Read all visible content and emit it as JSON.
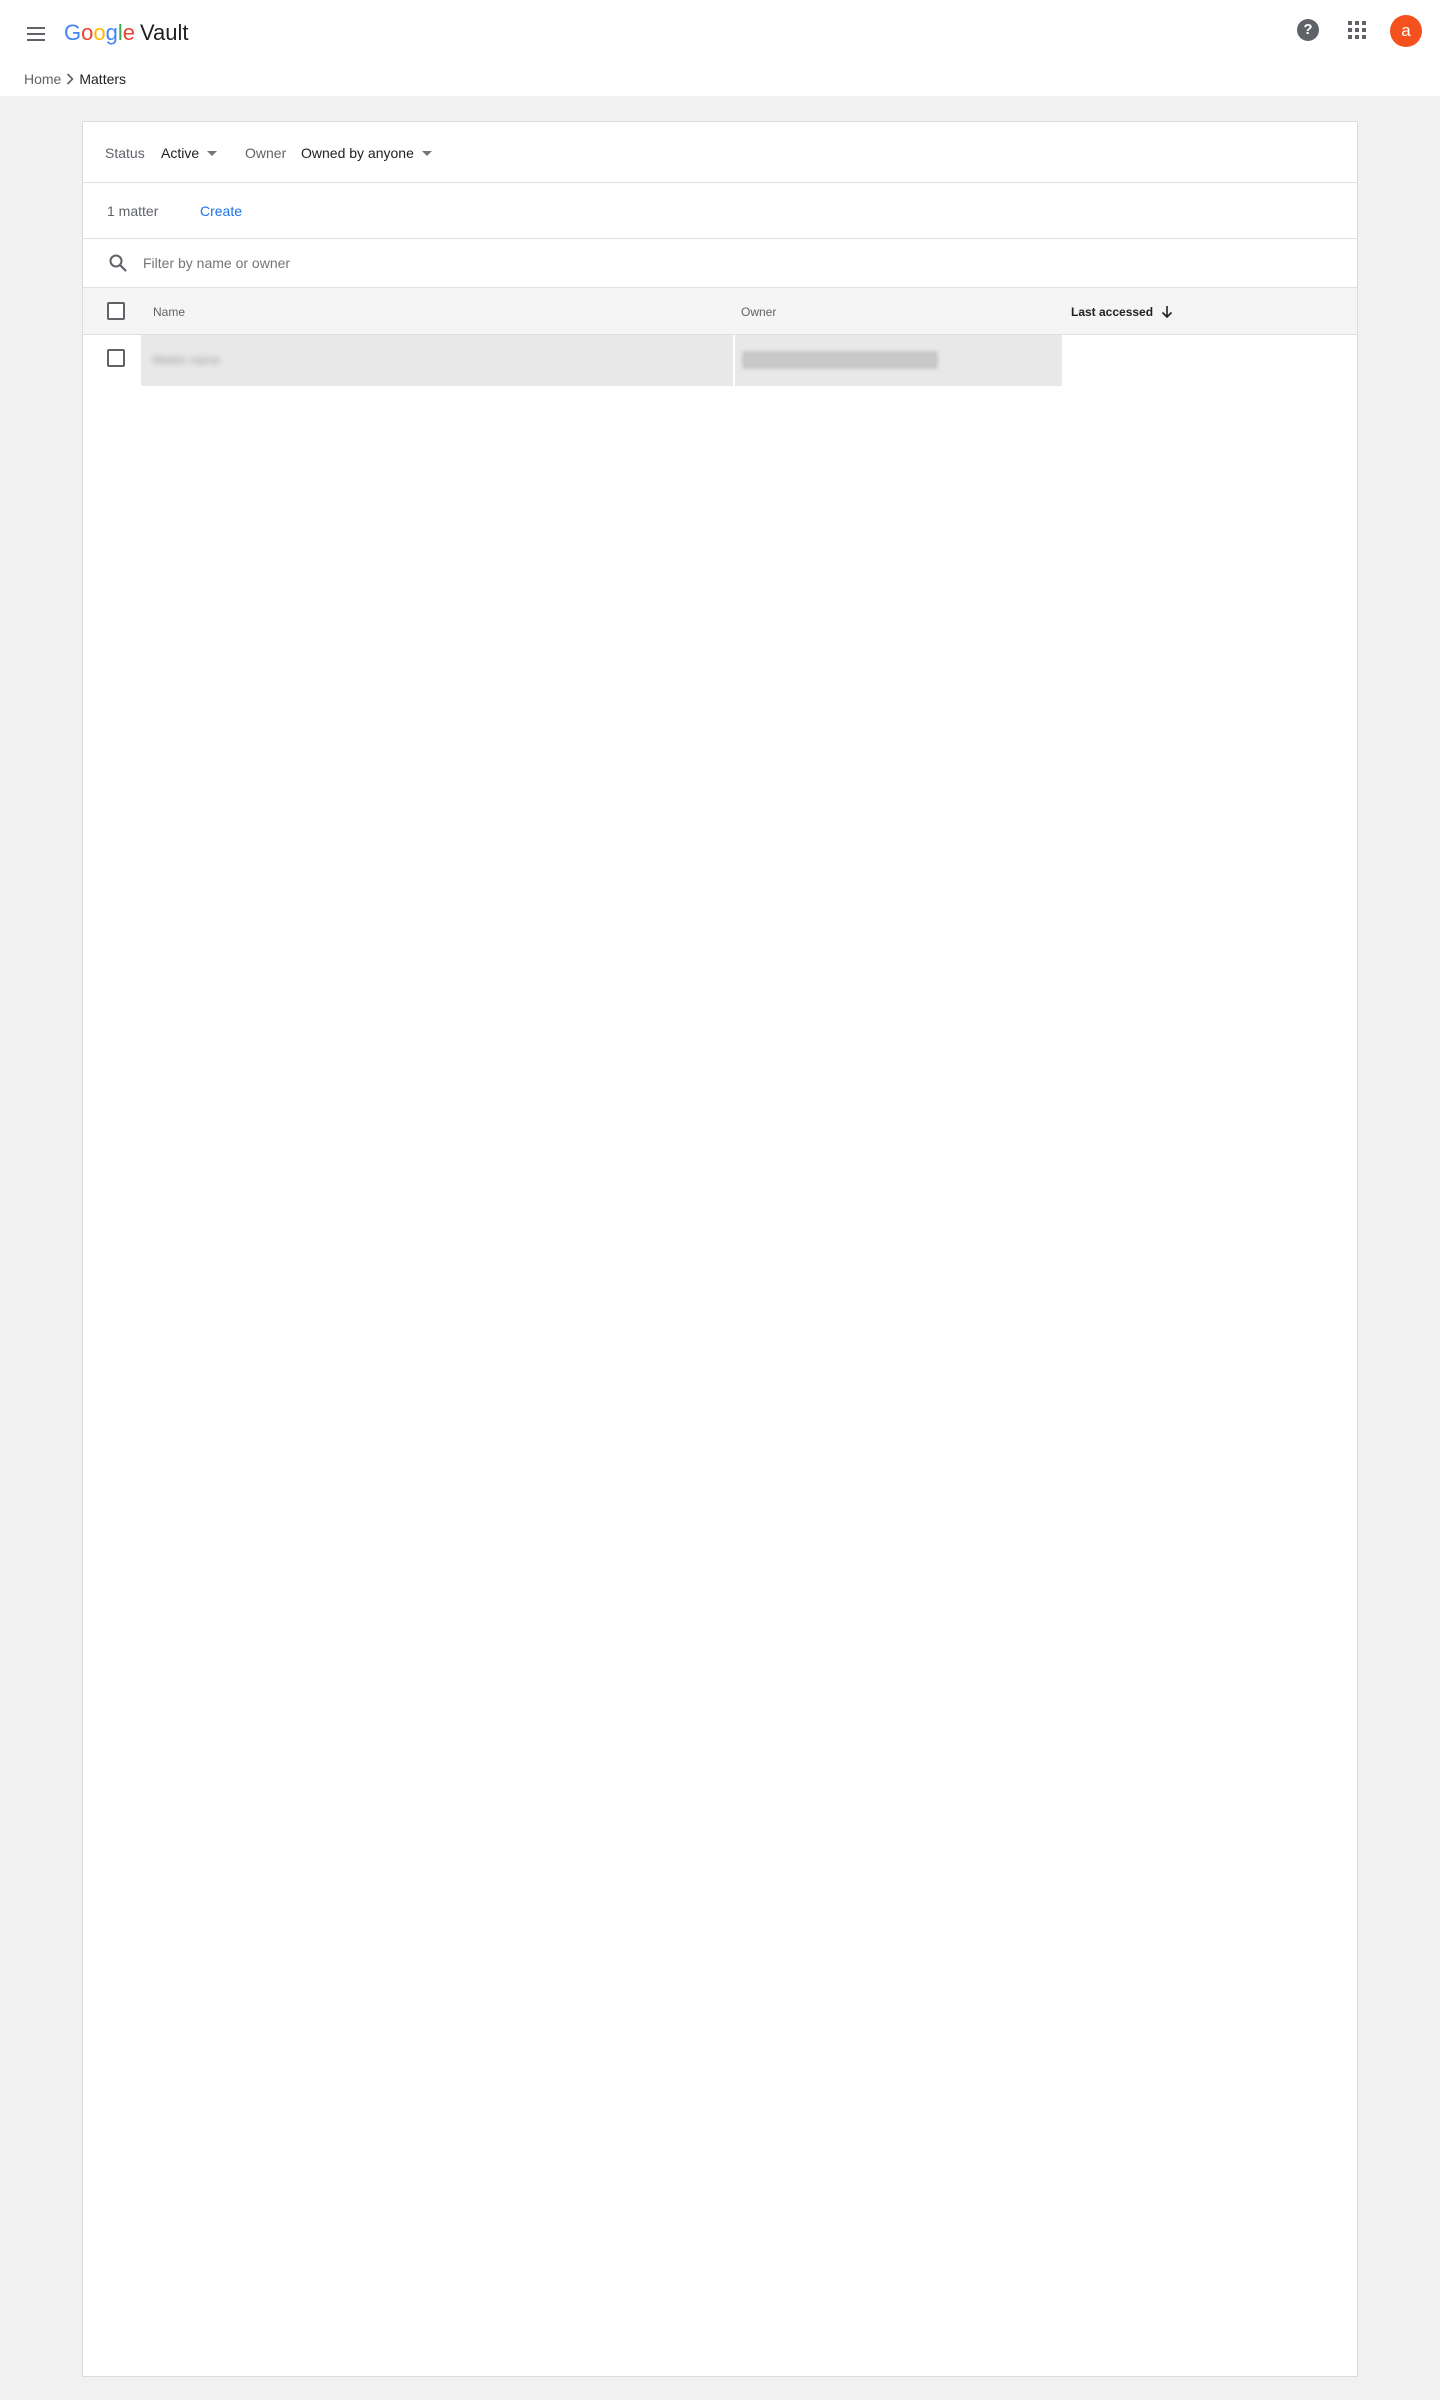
{
  "header": {
    "logo": {
      "g1": "G",
      "g2": "o",
      "g3": "o",
      "g4": "g",
      "g5": "l",
      "g6": "e",
      "product": "Vault"
    },
    "help_glyph": "?",
    "avatar_initial": "a",
    "icons": [
      "menu-icon",
      "help-icon",
      "apps-grid-icon"
    ]
  },
  "breadcrumb": {
    "home": "Home",
    "current": "Matters"
  },
  "filters": {
    "status_label": "Status",
    "status_value": "Active",
    "owner_label": "Owner",
    "owner_value": "Owned by anyone"
  },
  "actions": {
    "count": "1 matter",
    "create": "Create"
  },
  "search": {
    "placeholder": "Filter by name or owner"
  },
  "table": {
    "columns": [
      "Name",
      "Owner",
      "Last accessed"
    ],
    "sorted_column": "Last accessed",
    "sort_direction": "descending",
    "rows": [
      {
        "name": "Matter name",
        "owner": "",
        "last_accessed": ""
      }
    ]
  },
  "colors": {
    "accent": "#1a73e8",
    "avatar": "#f4511e",
    "background": "#f1f1f1"
  }
}
